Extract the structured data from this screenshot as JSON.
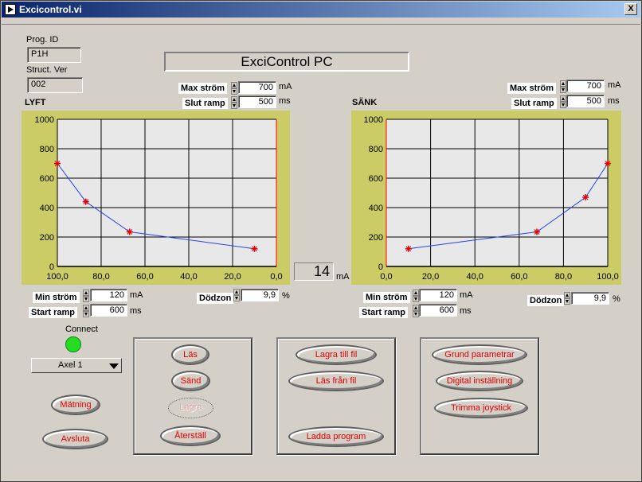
{
  "window": {
    "title": "Excicontrol.vi",
    "close_label": "X"
  },
  "header": {
    "prog_id_label": "Prog. ID",
    "prog_id_value": "P1H",
    "struct_ver_label": "Struct. Ver",
    "struct_ver_value": "002",
    "banner": "ExciControl PC"
  },
  "lyft": {
    "title": "LYFT",
    "max_strom_label": "Max ström",
    "max_strom_value": "700",
    "max_strom_unit": "mA",
    "slut_ramp_label": "Slut ramp",
    "slut_ramp_value": "500",
    "slut_ramp_unit": "ms",
    "min_strom_label": "Min ström",
    "min_strom_value": "120",
    "min_strom_unit": "mA",
    "start_ramp_label": "Start ramp",
    "start_ramp_value": "600",
    "start_ramp_unit": "ms",
    "dodzon_label": "Dödzon",
    "dodzon_value": "9,9",
    "dodzon_unit": "%"
  },
  "sank": {
    "title": "SÄNK",
    "max_strom_label": "Max ström",
    "max_strom_value": "700",
    "max_strom_unit": "mA",
    "slut_ramp_label": "Slut ramp",
    "slut_ramp_value": "500",
    "slut_ramp_unit": "ms",
    "min_strom_label": "Min ström",
    "min_strom_value": "120",
    "min_strom_unit": "mA",
    "start_ramp_label": "Start ramp",
    "start_ramp_value": "600",
    "start_ramp_unit": "ms",
    "dodzon_label": "Dödzon",
    "dodzon_value": "9,9",
    "dodzon_unit": "%"
  },
  "current_display": {
    "value": "14",
    "unit": "mA"
  },
  "connect": {
    "label": "Connect",
    "axis_selected": "Axel 1"
  },
  "buttons": {
    "matning": "Mätning",
    "avsluta": "Avsluta",
    "las": "Läs",
    "sand": "Sänd",
    "lagra": "Lagra",
    "aterstall": "Återställ",
    "lagra_till_fil": "Lagra till fil",
    "las_fran_fil": "Läs från fil",
    "ladda_program": "Ladda program",
    "grund_parametrar": "Grund parametrar",
    "digital_installning": "Digital inställning",
    "trimma_joystick": "Trimma joystick"
  },
  "colors": {
    "curve": "#2244ee",
    "marker": "#e00000",
    "graph_frame": "#cccc66",
    "plot_bg": "#e8e8e8"
  },
  "chart_data": [
    {
      "type": "line",
      "title": "LYFT",
      "x": [
        100,
        87,
        67,
        10
      ],
      "y": [
        700,
        440,
        235,
        120
      ],
      "xlim": [
        100,
        0
      ],
      "ylim": [
        0,
        1000
      ],
      "x_ticks": [
        "100,0",
        "80,0",
        "60,0",
        "40,0",
        "20,0",
        "0,0"
      ],
      "y_ticks": [
        "0",
        "200",
        "400",
        "600",
        "800",
        "1000"
      ],
      "grid": true
    },
    {
      "type": "line",
      "title": "SÄNK",
      "x": [
        10,
        68,
        90,
        100
      ],
      "y": [
        120,
        235,
        470,
        700
      ],
      "xlim": [
        0,
        100
      ],
      "ylim": [
        0,
        1000
      ],
      "x_ticks": [
        "0,0",
        "20,0",
        "40,0",
        "60,0",
        "80,0",
        "100,0"
      ],
      "y_ticks": [
        "0",
        "200",
        "400",
        "600",
        "800",
        "1000"
      ],
      "grid": true
    }
  ]
}
